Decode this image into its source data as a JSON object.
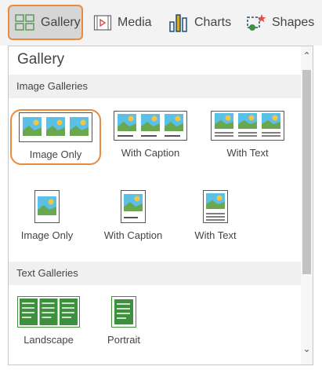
{
  "ribbon": {
    "tabs": [
      {
        "label": "Gallery",
        "icon": "gallery-icon"
      },
      {
        "label": "Media",
        "icon": "media-icon"
      },
      {
        "label": "Charts",
        "icon": "charts-icon"
      },
      {
        "label": "Shapes",
        "icon": "shapes-icon"
      }
    ]
  },
  "panel": {
    "title": "Gallery",
    "image_section": {
      "heading": "Image Galleries",
      "row1": [
        {
          "label": "Image Only"
        },
        {
          "label": "With Caption"
        },
        {
          "label": "With Text"
        }
      ],
      "row2": [
        {
          "label": "Image Only"
        },
        {
          "label": "With Caption"
        },
        {
          "label": "With Text"
        }
      ]
    },
    "text_section": {
      "heading": "Text Galleries",
      "items": [
        {
          "label": "Landscape"
        },
        {
          "label": "Portrait"
        }
      ]
    }
  },
  "colors": {
    "accent": "#ea8a3d",
    "image_sky": "#5bc0e8",
    "image_ground": "#6aa84f",
    "image_sun": "#f4c542",
    "text_gallery_green": "#3e8f3e",
    "chart_bar_blue": "#1f4e79",
    "chart_bar_gold": "#d9a82b",
    "media_red": "#d9534f"
  }
}
